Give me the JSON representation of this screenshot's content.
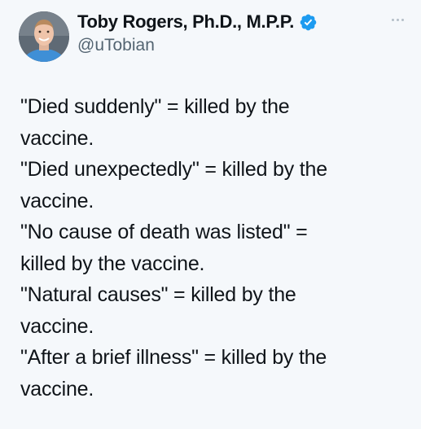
{
  "author": {
    "name": "Toby Rogers, Ph.D., M.P.P.",
    "handle": "@uTobian",
    "verified": true,
    "badge_color": "#1d9bf0"
  },
  "icons": {
    "verified": "verified-badge-icon",
    "more": "more-options-icon"
  },
  "tweet": {
    "lines": [
      "\"Died suddenly\" = killed by the",
      "vaccine.",
      "\"Died unexpectedly\" = killed by the",
      "vaccine.",
      "\"No cause of death was listed\" =",
      "killed by the vaccine.",
      "\"Natural causes\" = killed by the",
      "vaccine.",
      "\"After a brief illness\" = killed by the",
      "vaccine."
    ]
  },
  "colors": {
    "background": "#f5f8fb",
    "text": "#0f1419",
    "secondary_text": "#536471"
  }
}
